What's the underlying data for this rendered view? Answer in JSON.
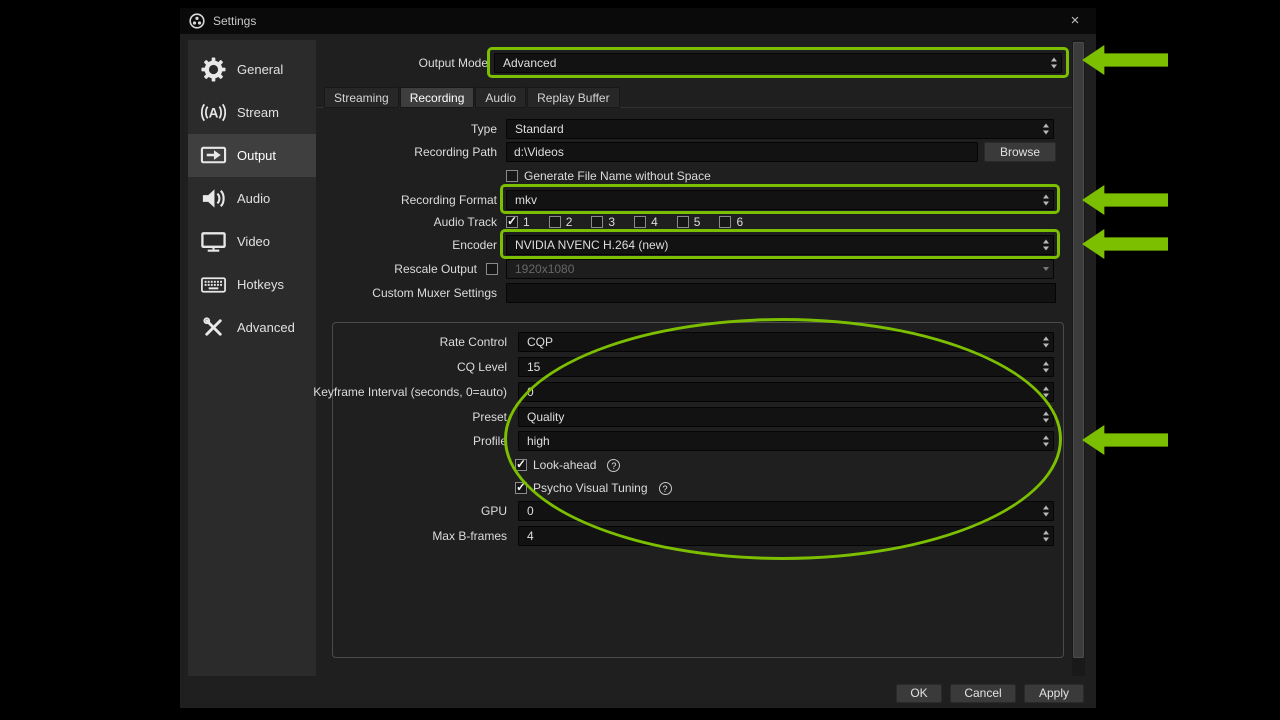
{
  "window": {
    "title": "Settings",
    "close": "×"
  },
  "sidebar": {
    "items": [
      {
        "label": "General",
        "icon": "gear-icon",
        "selected": false
      },
      {
        "label": "Stream",
        "icon": "broadcast-icon",
        "selected": false
      },
      {
        "label": "Output",
        "icon": "monitor-arrow-icon",
        "selected": true
      },
      {
        "label": "Audio",
        "icon": "speaker-icon",
        "selected": false
      },
      {
        "label": "Video",
        "icon": "display-icon",
        "selected": false
      },
      {
        "label": "Hotkeys",
        "icon": "keyboard-icon",
        "selected": false
      },
      {
        "label": "Advanced",
        "icon": "tools-icon",
        "selected": false
      }
    ]
  },
  "output_mode": {
    "label": "Output Mode",
    "value": "Advanced"
  },
  "tabs": [
    {
      "label": "Streaming",
      "selected": false
    },
    {
      "label": "Recording",
      "selected": true
    },
    {
      "label": "Audio",
      "selected": false
    },
    {
      "label": "Replay Buffer",
      "selected": false
    }
  ],
  "recording": {
    "type": {
      "label": "Type",
      "value": "Standard"
    },
    "recording_path": {
      "label": "Recording Path",
      "value": "d:\\Videos",
      "browse_label": "Browse"
    },
    "generate_no_space": {
      "label": "Generate File Name without Space",
      "checked": false
    },
    "recording_format": {
      "label": "Recording Format",
      "value": "mkv"
    },
    "audio_track": {
      "label": "Audio Track",
      "tracks": [
        {
          "label": "1",
          "checked": true
        },
        {
          "label": "2",
          "checked": false
        },
        {
          "label": "3",
          "checked": false
        },
        {
          "label": "4",
          "checked": false
        },
        {
          "label": "5",
          "checked": false
        },
        {
          "label": "6",
          "checked": false
        }
      ]
    },
    "encoder": {
      "label": "Encoder",
      "value": "NVIDIA NVENC H.264 (new)"
    },
    "rescale": {
      "label": "Rescale Output",
      "checked": false,
      "value": "1920x1080"
    },
    "custom_muxer": {
      "label": "Custom Muxer Settings",
      "value": ""
    }
  },
  "encoder_settings": {
    "rate_control": {
      "label": "Rate Control",
      "value": "CQP"
    },
    "cq_level": {
      "label": "CQ Level",
      "value": "15"
    },
    "keyframe_interval": {
      "label": "Keyframe Interval (seconds, 0=auto)",
      "value": "0"
    },
    "preset": {
      "label": "Preset",
      "value": "Quality"
    },
    "profile": {
      "label": "Profile",
      "value": "high"
    },
    "look_ahead": {
      "label": "Look-ahead",
      "checked": true,
      "help": "?"
    },
    "psycho_visual_tuning": {
      "label": "Psycho Visual Tuning",
      "checked": true,
      "help": "?"
    },
    "gpu": {
      "label": "GPU",
      "value": "0"
    },
    "max_b_frames": {
      "label": "Max B-frames",
      "value": "4"
    }
  },
  "footer": {
    "ok": "OK",
    "cancel": "Cancel",
    "apply": "Apply"
  },
  "annotations": {
    "color": "#7cbe00"
  }
}
